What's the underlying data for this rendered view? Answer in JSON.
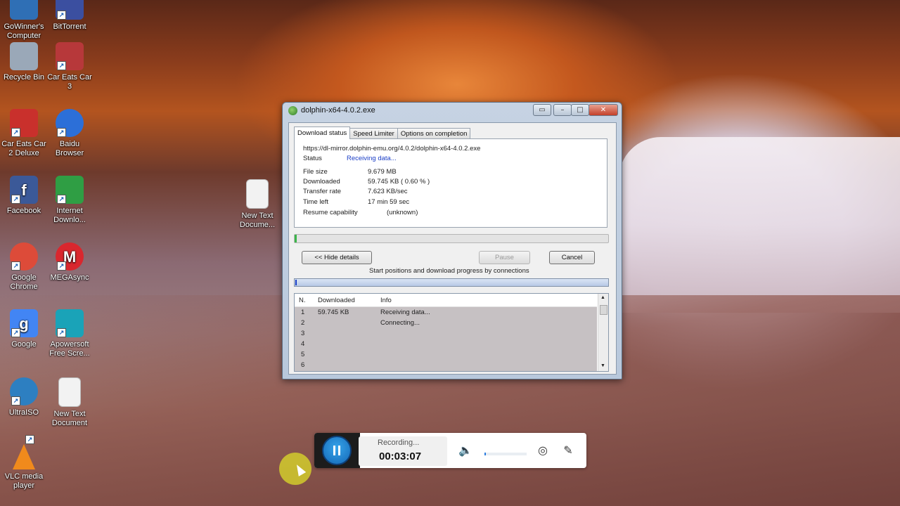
{
  "desktop": {
    "icons": [
      {
        "label": "GoWinner's\nComputer",
        "icon": "computer-icon",
        "color": "#2f6fb5"
      },
      {
        "label": "BitTorrent",
        "icon": "bittorrent-icon",
        "color": "#3b4fa0"
      },
      {
        "label": "Recycle Bin",
        "icon": "recycle-bin-icon",
        "color": "#9aa8b8"
      },
      {
        "label": "Car Eats Car\n3",
        "icon": "car-eats-car-3-icon",
        "color": "#b7383a"
      },
      {
        "label": "Car Eats Car\n2 Deluxe",
        "icon": "car-eats-car-2-icon",
        "color": "#c9302c"
      },
      {
        "label": "Baidu\nBrowser",
        "icon": "baidu-browser-icon",
        "color": "#2c6fd8"
      },
      {
        "label": "Facebook",
        "icon": "facebook-icon",
        "color": "#3b5998"
      },
      {
        "label": "Internet\nDownlo...",
        "icon": "idm-icon",
        "color": "#2f9e44"
      },
      {
        "label": "Google\nChrome",
        "icon": "chrome-icon",
        "color": "#dd4b39"
      },
      {
        "label": "MEGAsync",
        "icon": "mega-icon",
        "color": "#d9272e"
      },
      {
        "label": "Google",
        "icon": "google-icon",
        "color": "#4285f4"
      },
      {
        "label": "Apowersoft\nFree Scre...",
        "icon": "apowersoft-icon",
        "color": "#1aa3b8"
      },
      {
        "label": "UltraISO",
        "icon": "ultraiso-icon",
        "color": "#2d7fc1"
      },
      {
        "label": "New Text\nDocument",
        "icon": "text-document-icon",
        "color": "#f2f2f2"
      },
      {
        "label": "VLC media\nplayer",
        "icon": "vlc-icon",
        "color": "#f08a1c"
      },
      {
        "label": "New Text\nDocume...",
        "icon": "text-document-icon",
        "color": "#f2f2f2"
      }
    ]
  },
  "window": {
    "title": "dolphin-x64-4.0.2.exe",
    "tabs": [
      "Download status",
      "Speed Limiter",
      "Options on completion"
    ],
    "url": "https://dl-mirror.dolphin-emu.org/4.0.2/dolphin-x64-4.0.2.exe",
    "status_label": "Status",
    "status_value": "Receiving data...",
    "file_size_label": "File size",
    "file_size_value": "9.679  MB",
    "downloaded_label": "Downloaded",
    "downloaded_value": "59.745  KB  ( 0.60 % )",
    "transfer_rate_label": "Transfer rate",
    "transfer_rate_value": "7.623  KB/sec",
    "time_left_label": "Time left",
    "time_left_value": "17 min 59 sec",
    "resume_label": "Resume capability",
    "resume_value": "(unknown)",
    "progress_percent": 0.6,
    "hide_details_button": "<< Hide details",
    "pause_button": "Pause",
    "cancel_button": "Cancel",
    "connections_caption": "Start positions and download progress by connections",
    "list_headers": [
      "N.",
      "Downloaded",
      "Info"
    ],
    "rows": [
      {
        "n": "1",
        "downloaded": "59.745  KB",
        "info": "Receiving data..."
      },
      {
        "n": "2",
        "downloaded": "",
        "info": "Connecting..."
      },
      {
        "n": "3",
        "downloaded": "",
        "info": ""
      },
      {
        "n": "4",
        "downloaded": "",
        "info": ""
      },
      {
        "n": "5",
        "downloaded": "",
        "info": ""
      },
      {
        "n": "6",
        "downloaded": "",
        "info": ""
      }
    ]
  },
  "recorder": {
    "status": "Recording...",
    "time": "00:03:07"
  }
}
